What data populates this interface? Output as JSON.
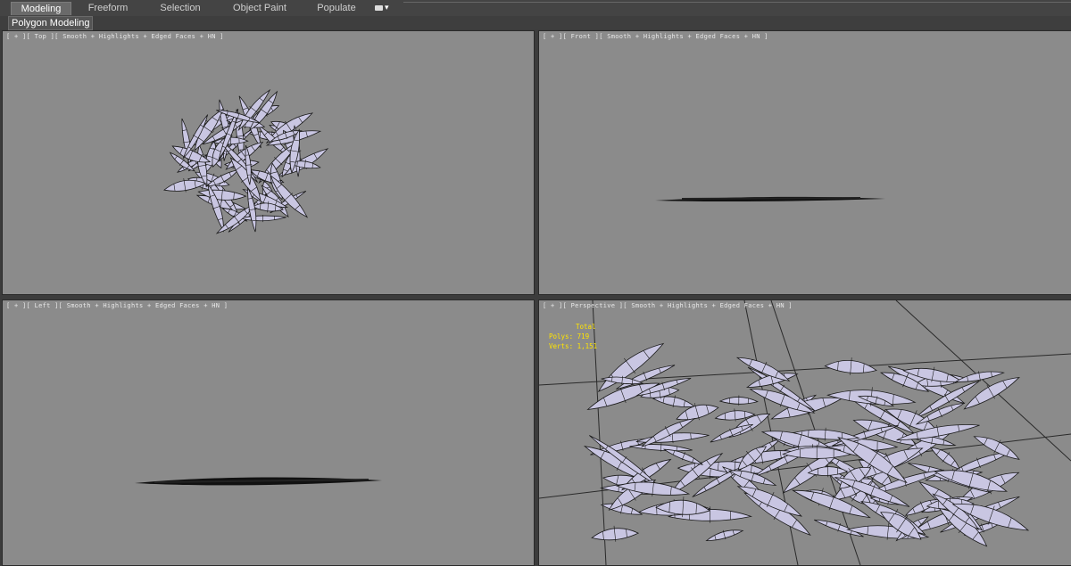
{
  "ribbon": {
    "tabs": [
      {
        "label": "Modeling",
        "active": true
      },
      {
        "label": "Freeform",
        "active": false
      },
      {
        "label": "Selection",
        "active": false
      },
      {
        "label": "Object Paint",
        "active": false
      },
      {
        "label": "Populate",
        "active": false
      }
    ],
    "sub_label": "Polygon Modeling"
  },
  "viewports": {
    "top": {
      "label": "[ + ][ Top ][ Smooth + Highlights + Edged Faces + HN ]"
    },
    "front": {
      "label": "[ + ][ Front ][ Smooth + Highlights + Edged Faces + HN ]"
    },
    "left": {
      "label": "[ + ][ Left ][ Smooth + Highlights + Edged Faces + HN ]"
    },
    "persp": {
      "label": "[ + ][ Perspective ][ Smooth + Highlights + Edged Faces + HN ]"
    }
  },
  "stats": {
    "header": "Total",
    "polys_label": "Polys:",
    "polys_value": "719",
    "verts_label": "Verts:",
    "verts_value": "1,151"
  },
  "colors": {
    "viewport_bg": "#8b8b8b",
    "mesh_fill": "#c9c6e2",
    "mesh_edge": "#1a1a1a",
    "stats_text": "#ffe400"
  }
}
